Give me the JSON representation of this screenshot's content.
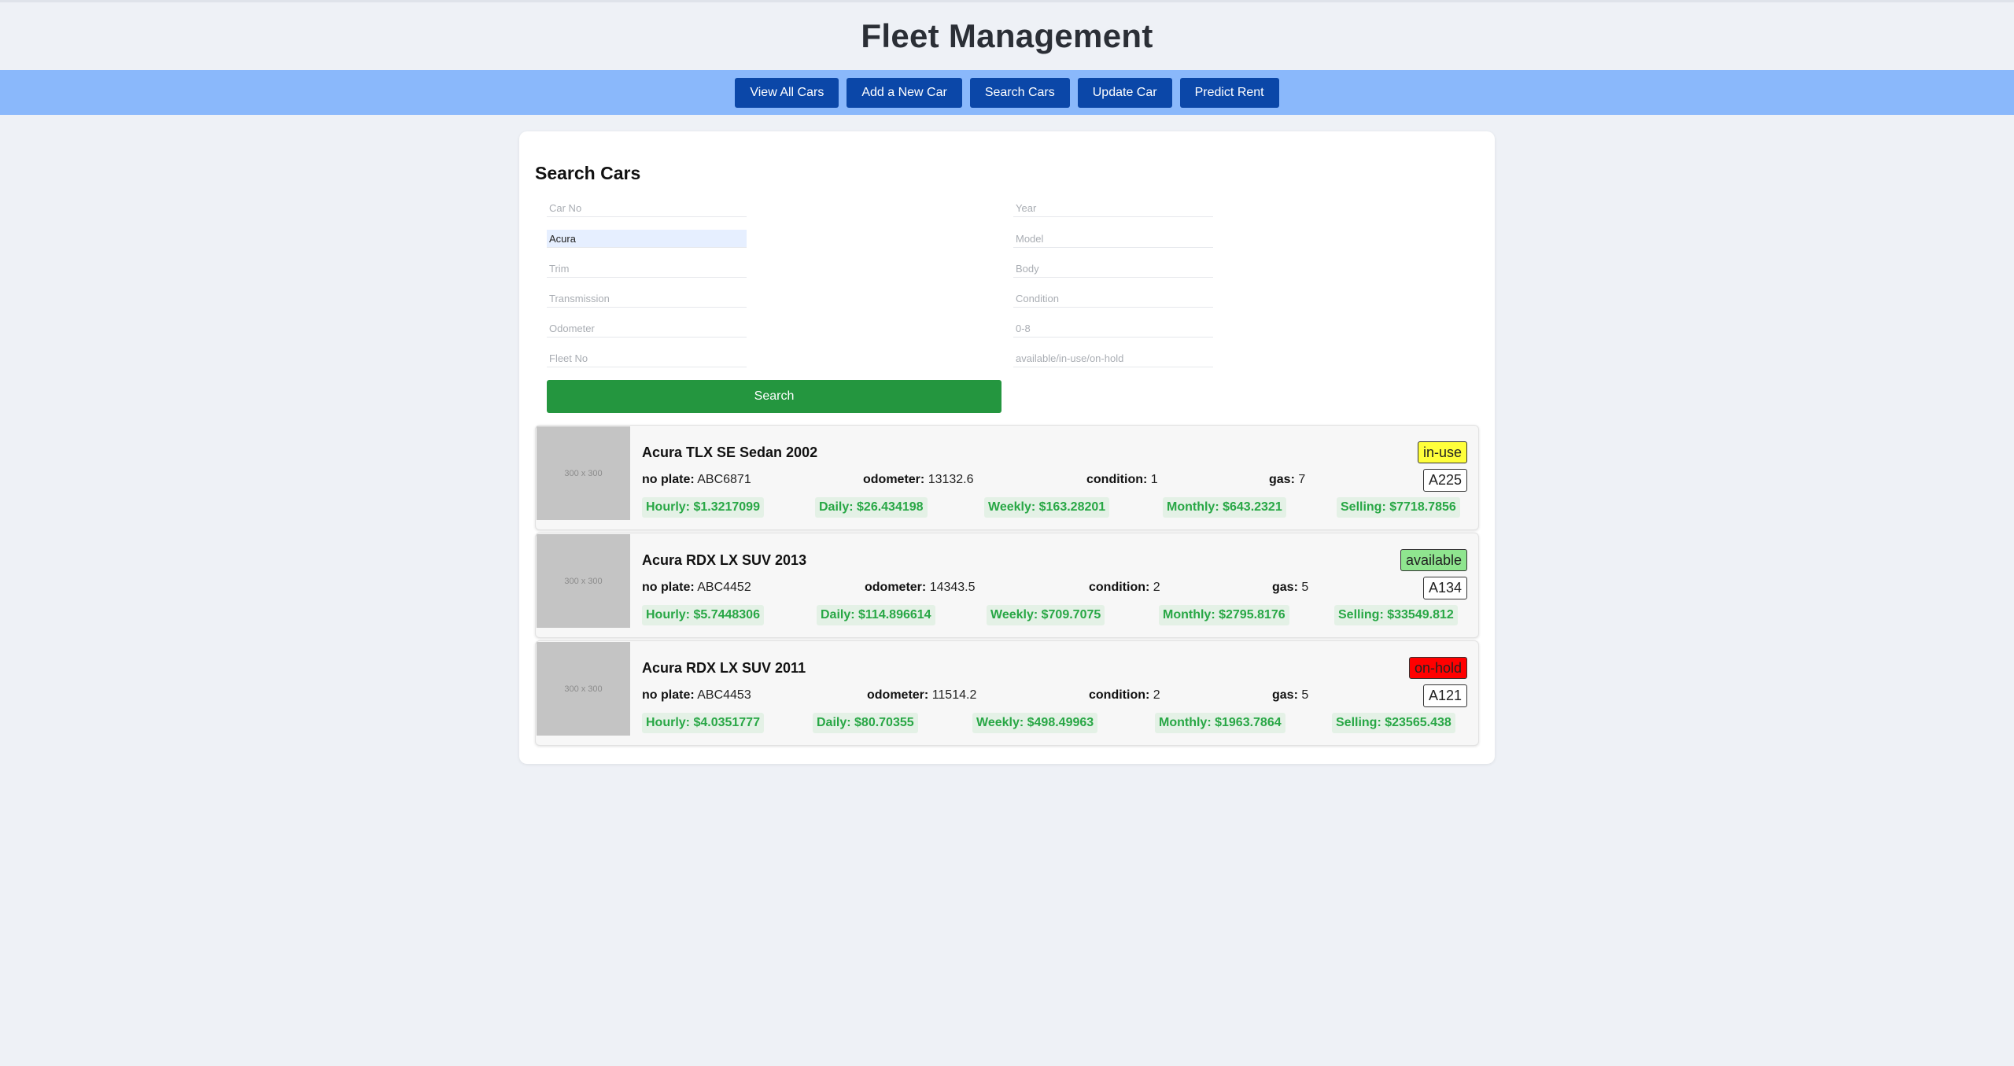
{
  "header": {
    "title": "Fleet Management"
  },
  "nav": {
    "view_all": "View All Cars",
    "add_new": "Add a New Car",
    "search": "Search Cars",
    "update": "Update Car",
    "predict": "Predict Rent"
  },
  "search_form": {
    "heading": "Search Cars",
    "fields": {
      "car_no": {
        "placeholder": "Car No",
        "value": ""
      },
      "year": {
        "placeholder": "Year",
        "value": ""
      },
      "make": {
        "placeholder": "",
        "value": "Acura"
      },
      "model": {
        "placeholder": "Model",
        "value": ""
      },
      "trim": {
        "placeholder": "Trim",
        "value": ""
      },
      "body": {
        "placeholder": "Body",
        "value": ""
      },
      "transmission": {
        "placeholder": "Transmission",
        "value": ""
      },
      "condition": {
        "placeholder": "Condition",
        "value": ""
      },
      "odometer": {
        "placeholder": "Odometer",
        "value": ""
      },
      "gas": {
        "placeholder": "0-8",
        "value": ""
      },
      "fleet_no": {
        "placeholder": "Fleet No",
        "value": ""
      },
      "status": {
        "placeholder": "available/in-use/on-hold",
        "value": ""
      }
    },
    "submit_label": "Search"
  },
  "labels": {
    "plate": "no plate:",
    "odometer": "odometer:",
    "condition": "condition:",
    "gas": "gas:"
  },
  "status_colors": {
    "in-use": "#ffff3b",
    "available": "#8fe58f",
    "on-hold": "#ff0000"
  },
  "results": [
    {
      "image_placeholder": "300 x 300",
      "title": "Acura TLX SE Sedan 2002",
      "status": "in-use",
      "fleet_no": "A225",
      "plate": "ABC6871",
      "odometer": "13132.6",
      "condition": "1",
      "gas": "7",
      "prices": {
        "hourly": "Hourly: $1.3217099",
        "daily": "Daily: $26.434198",
        "weekly": "Weekly: $163.28201",
        "monthly": "Monthly: $643.2321",
        "selling": "Selling: $7718.7856"
      }
    },
    {
      "image_placeholder": "300 x 300",
      "title": "Acura RDX LX SUV 2013",
      "status": "available",
      "fleet_no": "A134",
      "plate": "ABC4452",
      "odometer": "14343.5",
      "condition": "2",
      "gas": "5",
      "prices": {
        "hourly": "Hourly: $5.7448306",
        "daily": "Daily: $114.896614",
        "weekly": "Weekly: $709.7075",
        "monthly": "Monthly: $2795.8176",
        "selling": "Selling: $33549.812"
      }
    },
    {
      "image_placeholder": "300 x 300",
      "title": "Acura RDX LX SUV 2011",
      "status": "on-hold",
      "fleet_no": "A121",
      "plate": "ABC4453",
      "odometer": "11514.2",
      "condition": "2",
      "gas": "5",
      "prices": {
        "hourly": "Hourly: $4.0351777",
        "daily": "Daily: $80.70355",
        "weekly": "Weekly: $498.49963",
        "monthly": "Monthly: $1963.7864",
        "selling": "Selling: $23565.438"
      }
    }
  ]
}
